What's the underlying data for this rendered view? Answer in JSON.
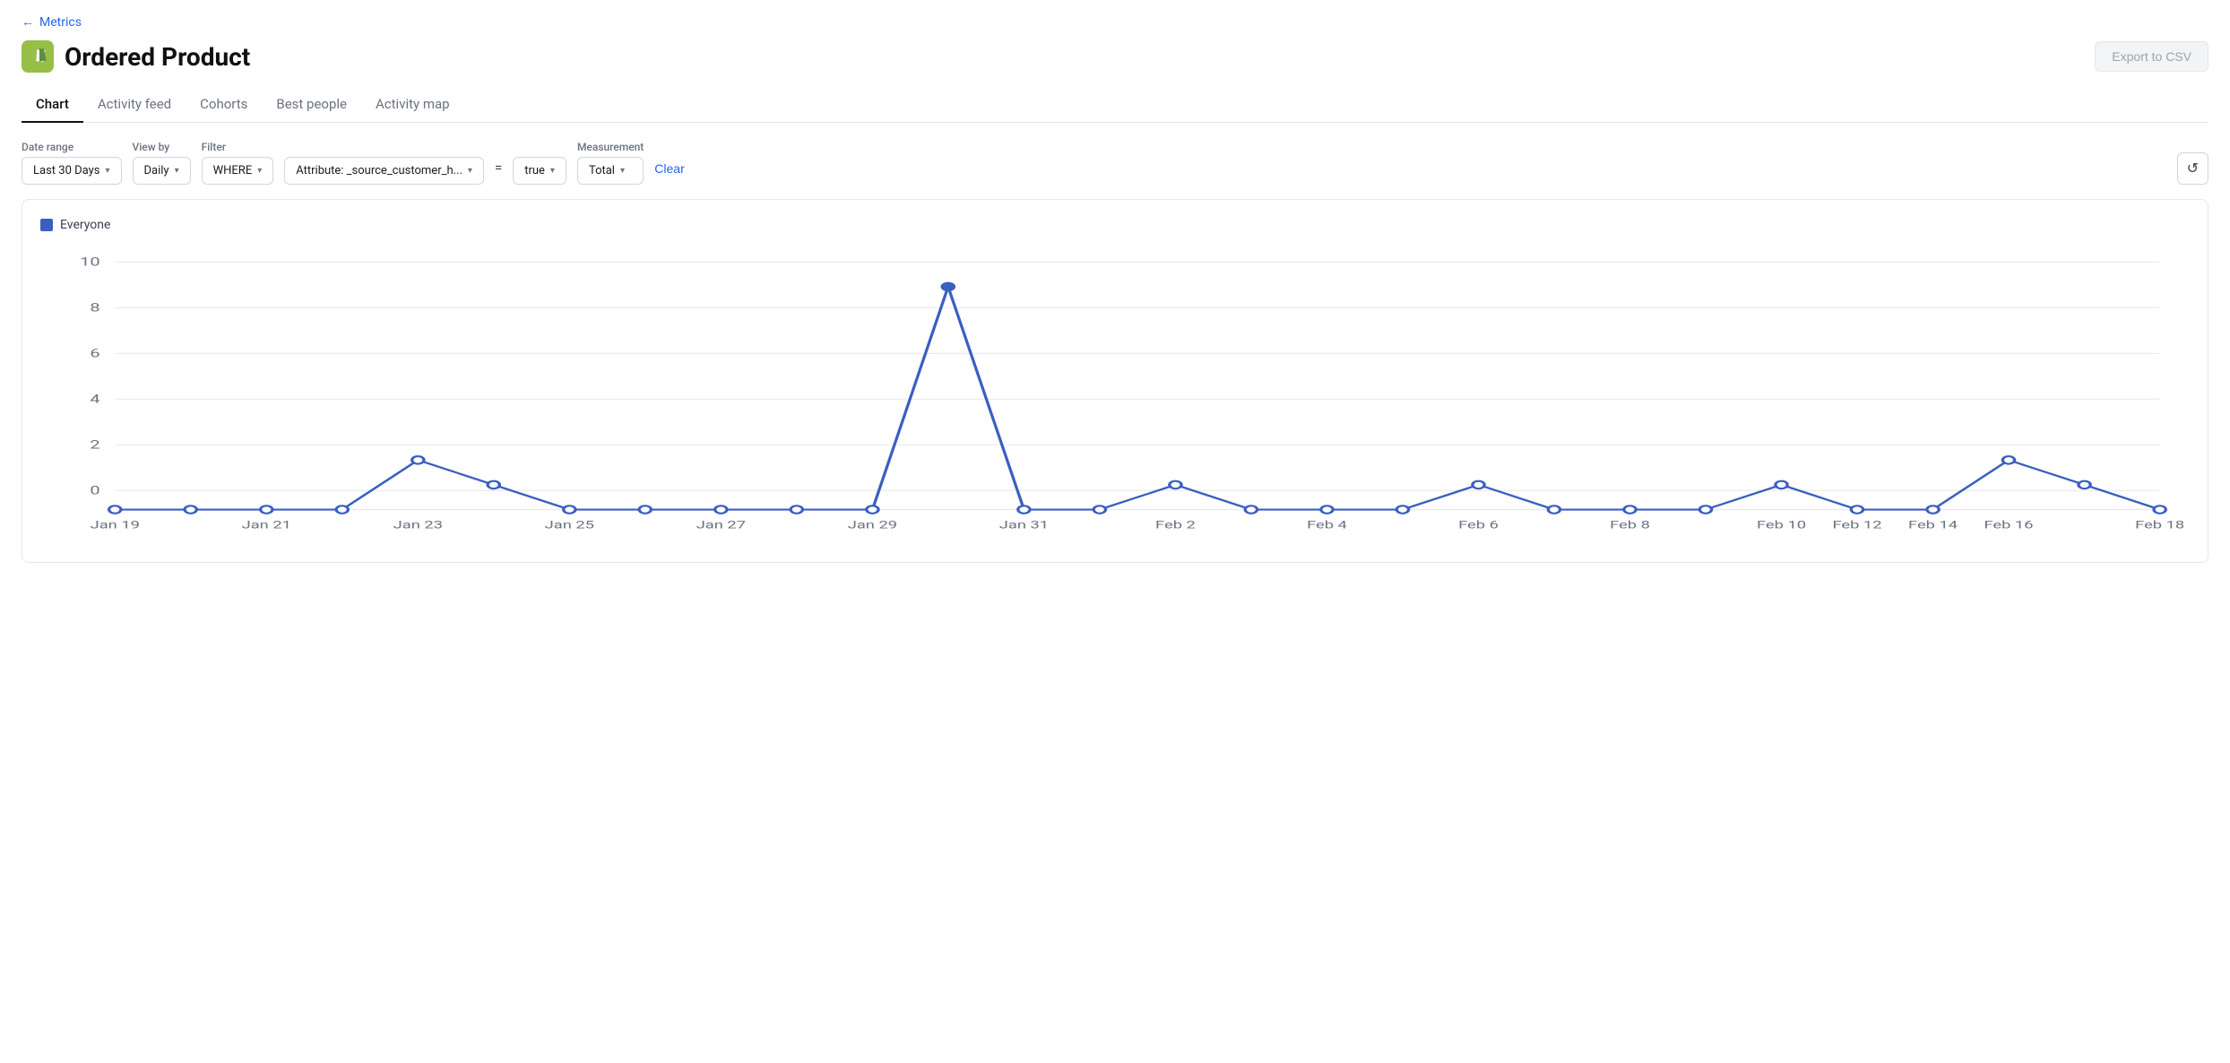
{
  "nav": {
    "back_label": "Metrics",
    "back_arrow": "←"
  },
  "header": {
    "title": "Ordered Product",
    "export_label": "Export to CSV"
  },
  "tabs": [
    {
      "id": "chart",
      "label": "Chart",
      "active": true
    },
    {
      "id": "activity-feed",
      "label": "Activity feed",
      "active": false
    },
    {
      "id": "cohorts",
      "label": "Cohorts",
      "active": false
    },
    {
      "id": "best-people",
      "label": "Best people",
      "active": false
    },
    {
      "id": "activity-map",
      "label": "Activity map",
      "active": false
    }
  ],
  "filters": {
    "date_range_label": "Date range",
    "date_range_value": "Last 30 Days",
    "view_by_label": "View by",
    "view_by_value": "Daily",
    "filter_label": "Filter",
    "where_value": "WHERE",
    "attribute_value": "Attribute: _source_customer_h...",
    "equals": "=",
    "true_value": "true",
    "measurement_label": "Measurement",
    "measurement_value": "Total",
    "clear_label": "Clear",
    "refresh_icon": "↺"
  },
  "chart": {
    "legend_label": "Everyone",
    "y_labels": [
      "10",
      "8",
      "6",
      "4",
      "2",
      "0"
    ],
    "x_labels": [
      "Jan 19",
      "Jan 21",
      "Jan 23",
      "Jan 25",
      "Jan 27",
      "Jan 29",
      "Jan 31",
      "Feb 2",
      "Feb 4",
      "Feb 6",
      "Feb 8",
      "Feb 10",
      "Feb 12",
      "Feb 14",
      "Feb 16",
      "Feb 18"
    ],
    "data_points": [
      {
        "x": 0,
        "y": 0
      },
      {
        "x": 1,
        "y": 0
      },
      {
        "x": 2,
        "y": 0
      },
      {
        "x": 3,
        "y": 0
      },
      {
        "x": 4,
        "y": 2
      },
      {
        "x": 5,
        "y": 1
      },
      {
        "x": 6,
        "y": 0
      },
      {
        "x": 7,
        "y": 0
      },
      {
        "x": 8,
        "y": 0
      },
      {
        "x": 9,
        "y": 0
      },
      {
        "x": 10,
        "y": 0
      },
      {
        "x": 11,
        "y": 9
      },
      {
        "x": 12,
        "y": 0
      },
      {
        "x": 13,
        "y": 0
      },
      {
        "x": 14,
        "y": 1
      },
      {
        "x": 15,
        "y": 0
      },
      {
        "x": 16,
        "y": 0
      },
      {
        "x": 17,
        "y": 0
      },
      {
        "x": 18,
        "y": 1
      },
      {
        "x": 19,
        "y": 0
      },
      {
        "x": 20,
        "y": 0
      },
      {
        "x": 21,
        "y": 0
      },
      {
        "x": 22,
        "y": 1
      },
      {
        "x": 23,
        "y": 0
      },
      {
        "x": 24,
        "y": 0
      },
      {
        "x": 25,
        "y": 2
      },
      {
        "x": 26,
        "y": 1
      },
      {
        "x": 27,
        "y": 0
      }
    ],
    "max_y": 10,
    "color": "#3b5fc0"
  }
}
